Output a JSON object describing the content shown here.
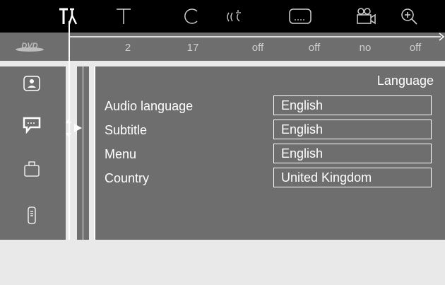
{
  "status_row": {
    "title_value": "2",
    "chapter_value": "17",
    "audio_value": "off",
    "subtitle_value": "off",
    "angle_value": "no",
    "zoom_value": "off",
    "logo_text": "DVD"
  },
  "top_icons": [
    "settings-icon",
    "title-icon",
    "chapter-icon",
    "audio-icon",
    "subtitle-icon",
    "angle-icon",
    "zoom-icon"
  ],
  "sidebar": {
    "items": [
      "picture-icon",
      "language-icon",
      "features-icon",
      "remote-icon"
    ]
  },
  "panel": {
    "title": "Language",
    "rows": [
      {
        "label": "Audio language",
        "value": "English"
      },
      {
        "label": "Subtitle",
        "value": "English"
      },
      {
        "label": "Menu",
        "value": "English"
      },
      {
        "label": "Country",
        "value": "United Kingdom"
      }
    ]
  },
  "colors": {
    "topbar": "#000000",
    "panel": "#6e6e6e",
    "background": "#e9e9e9",
    "text": "#ffffff"
  }
}
